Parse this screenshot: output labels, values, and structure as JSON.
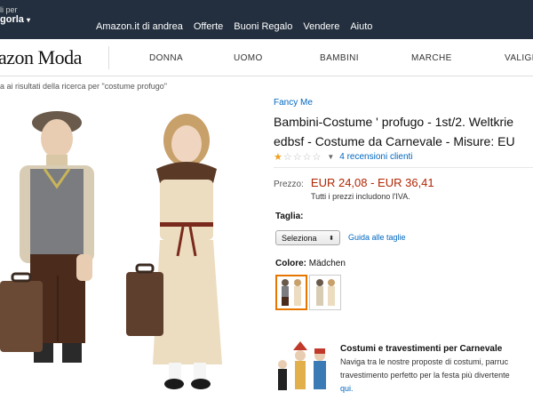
{
  "topbar": {
    "deliver_line1": "li per",
    "deliver_line2": "gorla",
    "links": [
      "Amazon.it di andrea",
      "Offerte",
      "Buoni Regalo",
      "Vendere",
      "Aiuto"
    ]
  },
  "moda": {
    "logo": "azon Moda",
    "nav": [
      "DONNA",
      "UOMO",
      "BAMBINI",
      "MARCHE",
      "VALIGE"
    ]
  },
  "breadcrumb": "a ai risultati della ricerca per \"costume profugo\"",
  "product": {
    "brand": "Fancy Me",
    "title_line1": "Bambini-Costume ' profugo - 1st/2. Weltkrie",
    "title_line2": "edbsf - Costume da Carnevale - Misure: EU",
    "rating_stars": 1,
    "reviews": "4 recensioni clienti",
    "price_label": "Prezzo:",
    "price": "EUR 24,08 - EUR 36,41",
    "tax_note": "Tutti i prezzi includono l'IVA.",
    "size_label": "Taglia:",
    "size_select": "Seleziona",
    "size_guide": "Guida alle taglie",
    "color_label": "Colore:",
    "color_value": "Mädchen"
  },
  "promo": {
    "title": "Costumi e travestimenti per Carnevale",
    "line1": "Naviga tra le nostre proposte di costumi, parruc",
    "line2": "travestimento perfetto per la festa più divertente",
    "link": "qui."
  },
  "colors": {
    "nav_bg": "#232f3e",
    "link": "#0066c0",
    "price": "#b12704",
    "star": "#f0a01a",
    "swatch_selected": "#e77600"
  }
}
